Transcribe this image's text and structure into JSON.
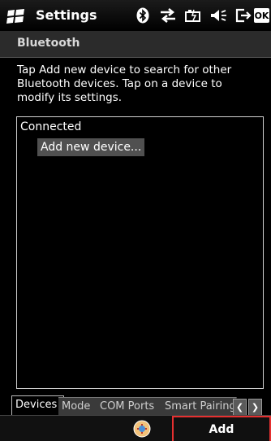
{
  "titlebar": {
    "title": "Settings",
    "ok_label": "OK",
    "icons": [
      "windows-start-icon",
      "bluetooth-icon",
      "connectivity-icon",
      "battery-icon",
      "volume-icon",
      "exit-icon"
    ]
  },
  "section": {
    "header": "Bluetooth"
  },
  "help_text": "Tap Add new device to search for other Bluetooth devices. Tap on a device to modify its settings.",
  "device_list": {
    "group_label": "Connected",
    "items": [
      "Add new device..."
    ]
  },
  "tabs": [
    {
      "label": "Devices",
      "active": true
    },
    {
      "label": "Mode",
      "active": false
    },
    {
      "label": "COM Ports",
      "active": false
    },
    {
      "label": "Smart Pairing",
      "active": false
    }
  ],
  "menubar": {
    "right_softkey": "Add",
    "center_icon": "input-panel-icon"
  },
  "colors": {
    "background": "#000000",
    "highlight": "#e53030"
  }
}
